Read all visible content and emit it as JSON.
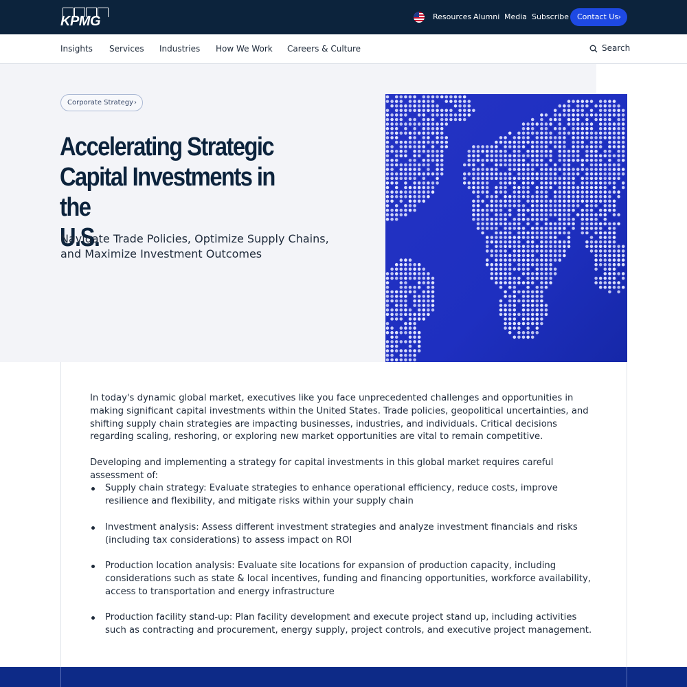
{
  "header": {
    "logo_text": "KPMG",
    "flag_icon": "us-flag-icon",
    "links": [
      "Resources",
      "Alumni",
      "Media",
      "Subscribe"
    ],
    "contact_label": "Contact Us"
  },
  "nav": {
    "items": [
      "Insights",
      "Services",
      "Industries",
      "How We Work",
      "Careers & Culture"
    ],
    "search_label": "Search",
    "search_icon": "search-icon"
  },
  "hero": {
    "chip_label": "Corporate Strategy",
    "title_lines": [
      "Accelerating Strategic",
      "Capital Investments in the",
      "U.S."
    ],
    "subtitle": "Navigate Trade Policies, Optimize Supply Chains, and Maximize Investment Outcomes",
    "image": "world-map-dots-image"
  },
  "body": {
    "intro": "In today's dynamic global market, executives like you face unprecedented challenges and opportunities in making significant capital investments within the United States. Trade policies, geopolitical uncertainties, and shifting supply chain strategies are impacting businesses, industries, and individuals. Critical decisions regarding scaling, reshoring, or exploring new market opportunities are vital to remain competitive.",
    "lead": "Developing and implementing a strategy for capital investments in this global market requires careful assessment of:",
    "bullets": [
      "Supply chain strategy: Evaluate strategies to enhance operational efficiency, reduce costs, improve resilience and flexibility, and mitigate risks within your supply chain",
      "Investment analysis: Assess different investment strategies and analyze investment financials and risks (including tax considerations) to assess impact on ROI",
      "Production location analysis: Evaluate site locations for expansion of production capacity, including considerations such as state & local incentives, funding and financing opportunities, workforce availability, access to transportation and energy infrastructure",
      "Production facility stand-up: Plan facility development and execute project stand up, including activities such as contracting and procurement, energy supply, project controls, and executive project management."
    ]
  },
  "colors": {
    "topbar": "#0c233c",
    "accent": "#1e49e2",
    "map_blue": "#1f2fbf",
    "footer": "#0d2a87"
  }
}
